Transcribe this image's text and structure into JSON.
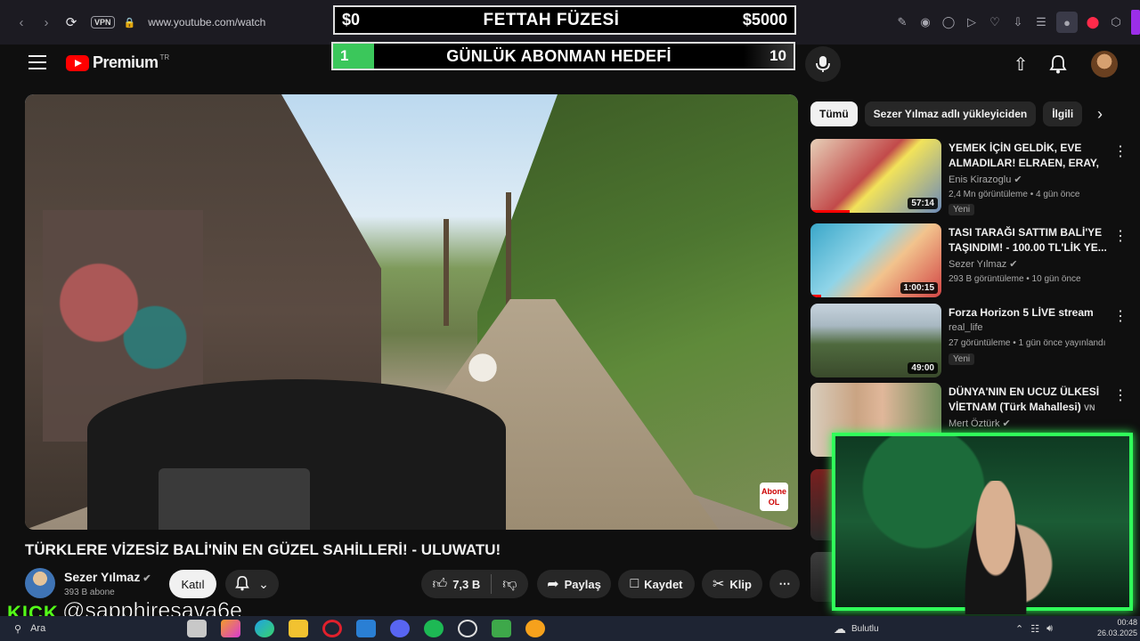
{
  "browser": {
    "url": "www.youtube.com/watch",
    "vpn_label": "VPN"
  },
  "overlay": {
    "rocket": {
      "left_amount": "$0",
      "title": "FETTAH FÜZESİ",
      "right_amount": "$5000"
    },
    "goal": {
      "current": "1",
      "title": "GÜNLÜK ABONMAN HEDEFİ",
      "target": "10",
      "progress_fraction": 0.1
    }
  },
  "header": {
    "brand": "Premium",
    "region": "TR"
  },
  "video": {
    "title": "TÜRKLERE VİZESİZ BALİ'NİN EN GÜZEL SAHİLLERİ! - ULUWATU!",
    "subscribe_badge": "Abone OL"
  },
  "channel": {
    "name": "Sezer Yılmaz",
    "subs": "393 B abone",
    "join_label": "Katıl"
  },
  "actions": {
    "likes": "7,3 B",
    "share": "Paylaş",
    "save": "Kaydet",
    "clip": "Klip"
  },
  "chips": [
    "Tümü",
    "Sezer Yılmaz adlı yükleyiciden",
    "İlgili"
  ],
  "recommendations": [
    {
      "title": "YEMEK İÇİN GELDİK, EVE ALMADILAR! ELRAEN, ERAY, ...",
      "channel": "Enis Kirazoglu",
      "meta": "2,4 Mn görüntüleme • 4 gün önce",
      "badge": "Yeni",
      "duration": "57:14",
      "progress": 0.3
    },
    {
      "title": "TASI TARAĞI SATTIM BALİ'YE TAŞINDIM! - 100.00 TL'LİK YE...",
      "channel": "Sezer Yılmaz",
      "meta": "293 B görüntüleme • 10 gün önce",
      "badge": "",
      "duration": "1:00:15",
      "progress": 0.08
    },
    {
      "title": "Forza Horizon 5  LİVE stream",
      "channel": "real_life",
      "meta": "27 görüntüleme • 1 gün önce yayınlandı",
      "badge": "Yeni",
      "duration": "49:00",
      "progress": 0
    },
    {
      "title": "DÜNYA'NIN EN UCUZ ÜLKESİ VİETNAM (Türk Mahallesi)",
      "title_suffix": "VN",
      "channel": "Mert Öztürk",
      "meta": "",
      "badge": "",
      "duration": "",
      "progress": 0
    }
  ],
  "streamer": {
    "platform": "KICK",
    "handle": "@sapphiresava6e"
  },
  "taskbar": {
    "search": "Ara",
    "weather": "Bulutlu",
    "time": "00:48",
    "date": "26.03.2025"
  },
  "colors": {
    "accent_green": "#30ff5a",
    "kick_green": "#53fc18",
    "youtube_red": "#ff0000",
    "goal_fill": "#3bc75b"
  },
  "icons": {
    "back": "arrow-left-icon",
    "forward": "arrow-right-icon",
    "reload": "reload-icon",
    "menu": "menu-icon",
    "mic": "mic-icon",
    "upload": "upload-icon",
    "bell": "bell-icon",
    "like": "thumbs-up-icon",
    "dislike": "thumbs-down-icon",
    "share": "share-icon",
    "save": "bookmark-icon",
    "clip": "scissors-icon",
    "more": "more-icon"
  }
}
